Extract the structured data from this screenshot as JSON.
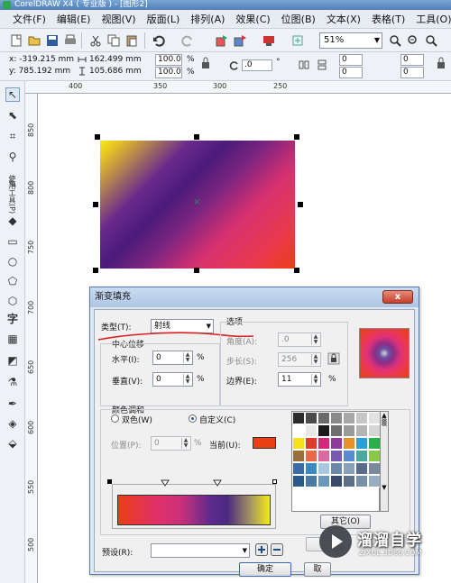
{
  "window": {
    "title": "CorelDRAW X4 ( 专业版 ) - [图形2]"
  },
  "menu": [
    "文件(F)",
    "编辑(E)",
    "视图(V)",
    "版面(L)",
    "排列(A)",
    "效果(C)",
    "位图(B)",
    "文本(X)",
    "表格(T)",
    "工具(O)"
  ],
  "toolbar": {
    "zoom": "51%"
  },
  "propbar": {
    "x": "x: -319.215 mm",
    "y": "y: 785.192 mm",
    "w": "162.499 mm",
    "h": "105.686 mm",
    "scale_x": "100.0",
    "scale_y": "100.0",
    "pct": "%",
    "rotate": ".0",
    "deg": "°",
    "c1": "0",
    "c2": "0",
    "c3": "0",
    "c4": "0"
  },
  "ruler": {
    "h_ticks": [
      "400",
      "350",
      "300",
      "250"
    ],
    "v_ticks": [
      "850",
      "800",
      "750",
      "700",
      "650",
      "600",
      "550",
      "500"
    ]
  },
  "toolbox": {
    "label": "使用工具(P)"
  },
  "dialog": {
    "title": "渐变填充",
    "close": "x",
    "type_label": "类型(T):",
    "type_value": "射线",
    "options_label": "选项",
    "center_offset_label": "中心位移",
    "horizontal_label": "水平(I):",
    "horizontal_value": "0",
    "vertical_label": "垂直(V):",
    "vertical_value": "0",
    "pct": "%",
    "angle_label": "角度(A):",
    "angle_value": ".0",
    "steps_label": "步长(S):",
    "steps_value": "256",
    "edge_label": "边界(E):",
    "edge_value": "11",
    "blend_label": "颜色调和",
    "two_color_label": "双色(W)",
    "custom_label": "自定义(C)",
    "position_label": "位置(P):",
    "position_value": "0",
    "current_label": "当前(U):",
    "current_color": "#ea3e14",
    "others_button": "其它(O)",
    "presets_label": "预设(R):",
    "presets_value": "",
    "ok_button": "确定",
    "cancel_button": "取"
  },
  "palette": [
    "#2b2b2b",
    "#4a4a4a",
    "#6a6a6a",
    "#8a8a8a",
    "#a8a8a8",
    "#c6c6c6",
    "#e2e2e2",
    "#ffffff",
    "#e8e8e8",
    "#1a1a1a",
    "#6e6e6e",
    "#9a9a9a",
    "#b4b4b4",
    "#d6d6d6",
    "#f6e21a",
    "#e23a2a",
    "#d02a7a",
    "#8e3a9a",
    "#e6922a",
    "#2aa0d8",
    "#2ab04a",
    "#9a6e3a",
    "#e86a4a",
    "#d86aa0",
    "#7a5ab0",
    "#5a8ad0",
    "#4aa8a0",
    "#8ac84a",
    "#3a6aa8",
    "#3a8ac0",
    "#a8c8e0",
    "#6a8aa8",
    "#8aa0b8",
    "#5a6a8a",
    "#7a8a9a",
    "#2a5a8a",
    "#4a7aa0",
    "#6a9ab8",
    "#3a4a6a",
    "#5a7088",
    "#7890a6",
    "#98aec0"
  ],
  "watermark": {
    "brand": "溜溜自学",
    "url": "ZIXUE.3D66.COM"
  }
}
